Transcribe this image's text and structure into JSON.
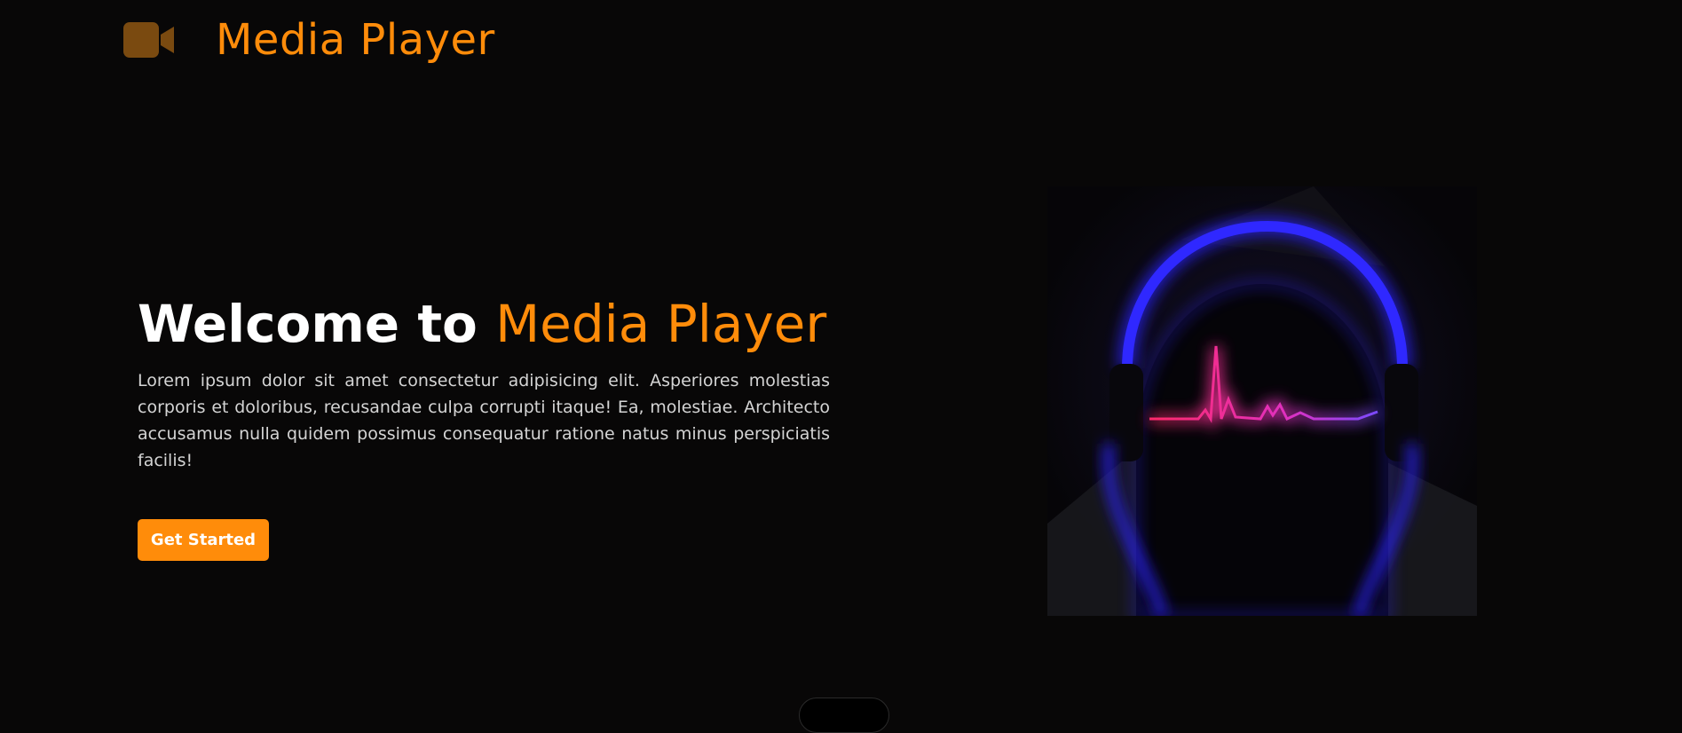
{
  "header": {
    "logo_icon": "video-camera-icon",
    "title": "Media Player"
  },
  "hero": {
    "heading_prefix": "Welcome to",
    "heading_accent": "Media Player",
    "body": "Lorem ipsum dolor sit amet consectetur adipisicing elit. Asperiores molestias corporis et doloribus, recusandae culpa corrupti itaque! Ea, molestiae. Architecto accusamus nulla quidem possimus consequatur ratione natus minus perspiciatis facilis!",
    "cta_label": "Get Started",
    "image_icon": "headphones-illustration"
  },
  "colors": {
    "accent": "#ff8c0a",
    "background": "#080707",
    "logo_icon": "#7a4a10",
    "neon_blue": "#2a22ff",
    "neon_pink": "#ff2a8a"
  }
}
